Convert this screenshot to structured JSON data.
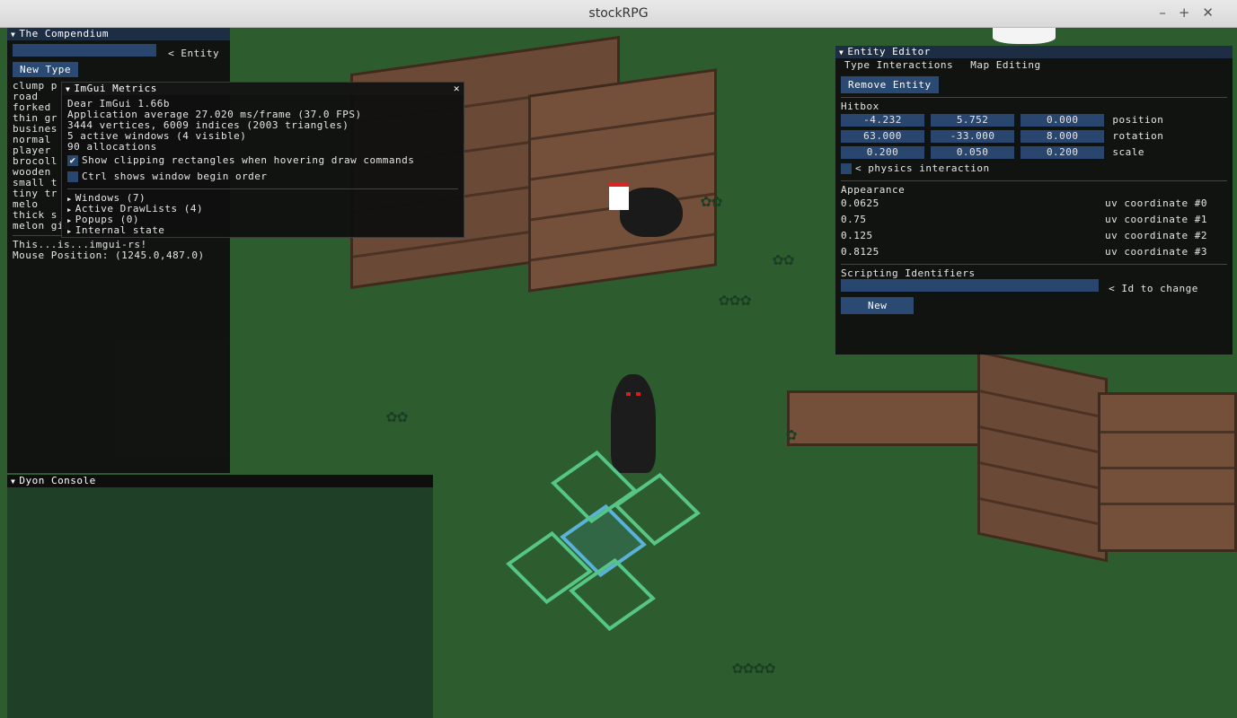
{
  "window": {
    "title": "stockRPG",
    "controls": [
      "–",
      "+",
      "✕"
    ]
  },
  "compendium": {
    "title": "The Compendium",
    "entity_label": "< Entity",
    "new_type_label": "New Type",
    "items": [
      "clump p",
      "road",
      "forked",
      "thin gr",
      "busines",
      "normal",
      "player",
      "brocoll",
      "wooden",
      "small t",
      "tiny tr",
      "melo",
      "thick s",
      "melon gib"
    ],
    "footer": [
      "This...is...imgui-rs!",
      "Mouse Position: (1245.0,487.0)"
    ]
  },
  "metrics": {
    "title": "ImGui Metrics",
    "close": "✕",
    "lines": [
      "Dear ImGui 1.66b",
      "Application average 27.020 ms/frame (37.0 FPS)",
      "3444 vertices, 6009 indices (2003 triangles)",
      "5 active windows (4 visible)",
      "90 allocations"
    ],
    "checkbox1": "Show clipping rectangles when hovering draw commands",
    "checkbox2": "Ctrl shows window begin order",
    "tree": [
      "Windows (7)",
      "Active DrawLists (4)",
      "Popups (0)",
      "Internal state"
    ]
  },
  "editor": {
    "title": "Entity Editor",
    "menu": [
      "Type Interactions",
      "Map Editing"
    ],
    "remove_label": "Remove Entity",
    "hitbox_label": "Hitbox",
    "rows": [
      {
        "values": [
          "-4.232",
          "5.752",
          "0.000"
        ],
        "label": "position"
      },
      {
        "values": [
          "63.000",
          "-33.000",
          "8.000"
        ],
        "label": "rotation"
      },
      {
        "values": [
          "0.200",
          "0.050",
          "0.200"
        ],
        "label": "scale"
      }
    ],
    "physics_label": "< physics interaction",
    "appearance_label": "Appearance",
    "uv": [
      {
        "value": "0.0625",
        "label": "uv coordinate #0"
      },
      {
        "value": "0.75",
        "label": "uv coordinate #1"
      },
      {
        "value": "0.125",
        "label": "uv coordinate #2"
      },
      {
        "value": "0.8125",
        "label": "uv coordinate #3"
      }
    ],
    "scripting_label": "Scripting Identifiers",
    "id_label": "< Id to change",
    "new_label": "New"
  },
  "console": {
    "title": "Dyon Console"
  }
}
